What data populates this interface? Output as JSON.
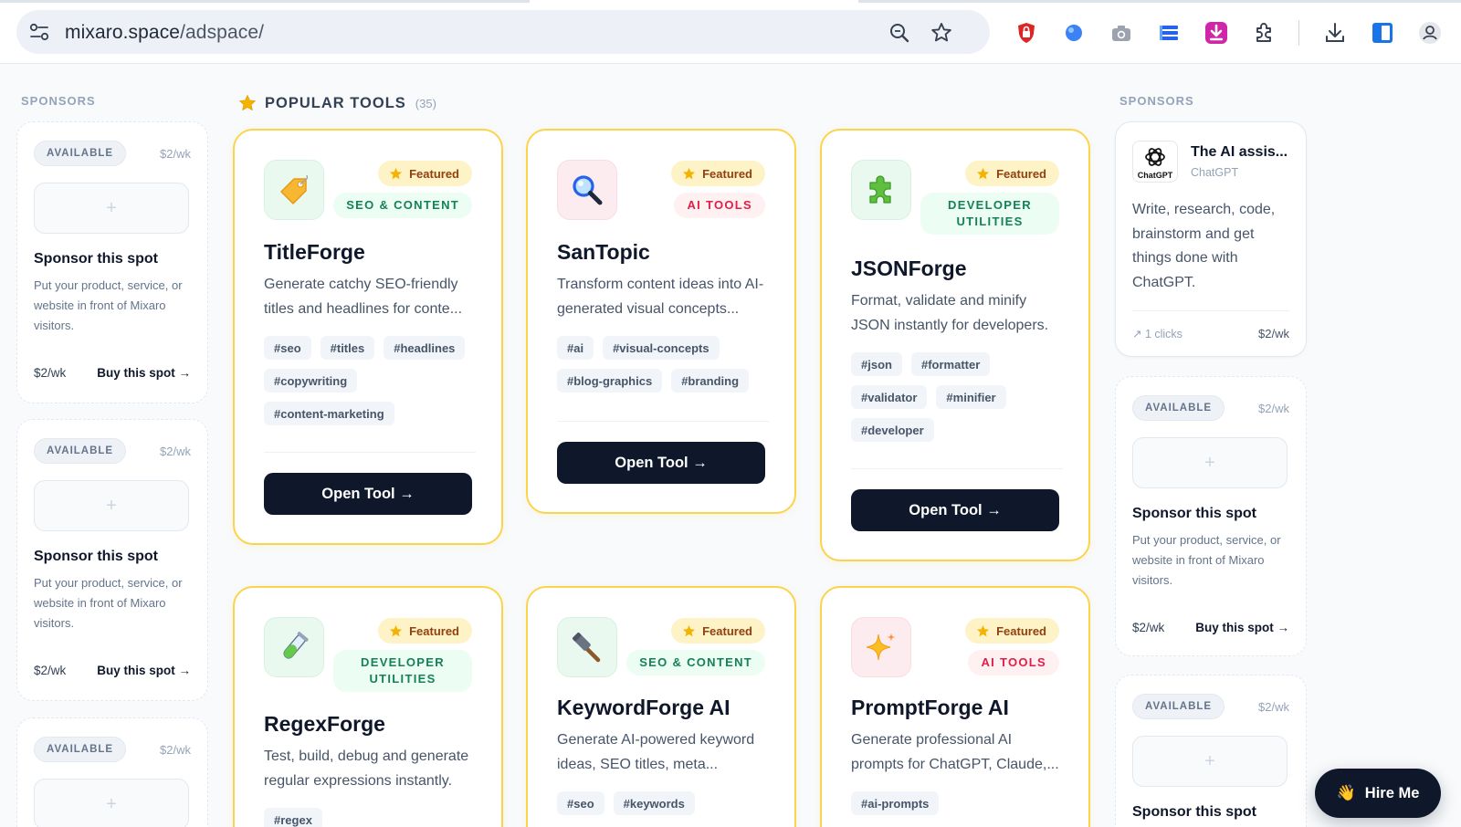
{
  "browser": {
    "url_domain": "mixaro.space",
    "url_path": "/adspace/",
    "icons": [
      "site-settings-icon",
      "zoom-icon",
      "bookmark-star-icon",
      "adblock-shield-icon",
      "blue-dot-extension-icon",
      "camera-icon",
      "list-extension-icon",
      "download-extension-icon",
      "extensions-puzzle-icon",
      "downloads-icon",
      "sidebar-icon",
      "profile-icon"
    ]
  },
  "left_sidebar": {
    "label": "SPONSORS",
    "cards": [
      {
        "status": "AVAILABLE",
        "price": "$2/wk",
        "slot": "+",
        "title": "Sponsor this spot",
        "desc": "Put your product, service, or website in front of Mixaro visitors.",
        "price_bottom": "$2/wk",
        "buy": "Buy this spot →"
      },
      {
        "status": "AVAILABLE",
        "price": "$2/wk",
        "slot": "+",
        "title": "Sponsor this spot",
        "desc": "Put your product, service, or website in front of Mixaro visitors.",
        "price_bottom": "$2/wk",
        "buy": "Buy this spot →"
      },
      {
        "status": "AVAILABLE",
        "price": "$2/wk",
        "slot": "+"
      }
    ]
  },
  "right_sidebar": {
    "label": "SPONSORS",
    "ad": {
      "logo_text": "ChatGPT",
      "name": "The AI assis...",
      "brand": "ChatGPT",
      "desc": "Write, research, code, brainstorm and get things done with ChatGPT.",
      "clicks": "↗ 1 clicks",
      "price": "$2/wk"
    },
    "cards": [
      {
        "status": "AVAILABLE",
        "price": "$2/wk",
        "slot": "+",
        "title": "Sponsor this spot",
        "desc": "Put your product, service, or website in front of Mixaro visitors.",
        "price_bottom": "$2/wk",
        "buy": "Buy this spot →"
      },
      {
        "status": "AVAILABLE",
        "price": "$2/wk",
        "slot": "+",
        "title": "Sponsor this spot"
      }
    ]
  },
  "main": {
    "title": "POPULAR TOOLS",
    "count": "(35)",
    "tools": [
      {
        "icon": "price-tag-icon",
        "featured": "Featured",
        "category": "SEO & CONTENT",
        "name": "TitleForge",
        "desc": "Generate catchy SEO-friendly titles and headlines for conte...",
        "tags": [
          "#seo",
          "#titles",
          "#headlines",
          "#copywriting",
          "#content-marketing"
        ],
        "button": "Open Tool →"
      },
      {
        "icon": "magnifier-icon",
        "featured": "Featured",
        "category": "AI TOOLS",
        "name": "SanTopic",
        "desc": "Transform content ideas into AI-generated visual concepts...",
        "tags": [
          "#ai",
          "#visual-concepts",
          "#blog-graphics",
          "#branding"
        ],
        "button": "Open Tool →"
      },
      {
        "icon": "puzzle-piece-icon",
        "featured": "Featured",
        "category": "DEVELOPER UTILITIES",
        "name": "JSONForge",
        "desc": "Format, validate and minify JSON instantly for developers.",
        "tags": [
          "#json",
          "#formatter",
          "#validator",
          "#minifier",
          "#developer"
        ],
        "button": "Open Tool →"
      },
      {
        "icon": "test-tube-icon",
        "featured": "Featured",
        "category": "DEVELOPER UTILITIES",
        "name": "RegexForge",
        "desc": "Test, build, debug and generate regular expressions instantly.",
        "tags": [
          "#regex"
        ]
      },
      {
        "icon": "hammer-icon",
        "featured": "Featured",
        "category": "SEO & CONTENT",
        "name": "KeywordForge AI",
        "desc": "Generate AI-powered keyword ideas, SEO titles, meta...",
        "tags": [
          "#seo",
          "#keywords"
        ]
      },
      {
        "icon": "sparkles-icon",
        "featured": "Featured",
        "category": "AI TOOLS",
        "name": "PromptForge AI",
        "desc": "Generate professional AI prompts for ChatGPT, Claude,...",
        "tags": [
          "#ai-prompts"
        ]
      }
    ]
  },
  "hire_button": {
    "emoji": "👋",
    "label": "Hire Me"
  }
}
